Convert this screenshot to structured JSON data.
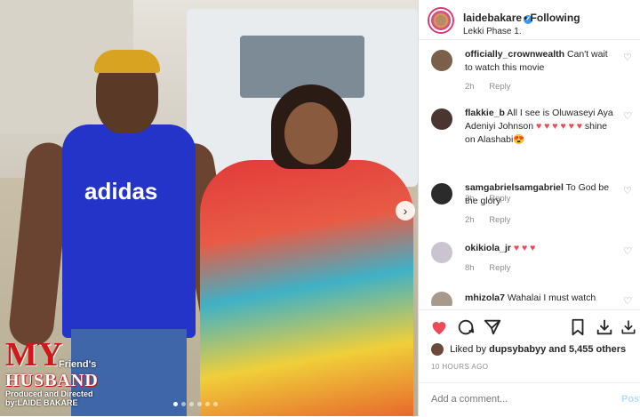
{
  "post": {
    "poster_title_line1": "MY",
    "poster_title_friends": "Friend's",
    "poster_title_line2": "HUSBAND",
    "poster_credit_line1": "Produced and Directed",
    "poster_credit_line2": "by:LAIDE BAKARE",
    "shirt_text": "adidas",
    "carousel_dots": 6,
    "active_dot": 0
  },
  "header": {
    "username": "laidebakare",
    "follow_label": "Following",
    "location": "Lekki Phase 1."
  },
  "comments": [
    {
      "user": "officially_crownwealth",
      "text": "Can't wait to watch this movie",
      "hearts": "",
      "emoji": "",
      "time": "2h",
      "reply": "Reply",
      "avatar_color": "#7a6048"
    },
    {
      "user": "flakkie_b",
      "text": "All I see is Oluwaseyi Aya Adeniyi Johnson",
      "hearts": "♥ ♥ ♥ ♥ ♥ ♥",
      "text2": "shine on Alashabi",
      "emoji": "😍",
      "time": "2h",
      "reply": "Reply",
      "avatar_color": "#4a3530"
    },
    {
      "user": "samgabrielsamgabriel",
      "text": "To God be the glory",
      "hearts": "",
      "emoji": "",
      "time": "2h",
      "reply": "Reply",
      "avatar_color": "#2b2b2b"
    },
    {
      "user": "okikiola_jr",
      "text": "",
      "hearts": "♥ ♥ ♥",
      "emoji": "",
      "time": "8h",
      "reply": "Reply",
      "avatar_color": "#c9c4cf"
    },
    {
      "user": "mhizola7",
      "text": "Wahalai I must watch",
      "hearts": "",
      "emoji": "",
      "time": "",
      "reply": "",
      "avatar_color": "#a89a8a"
    }
  ],
  "likes": {
    "prefix": "Liked by",
    "user": "dupsybabyy",
    "suffix": "and 5,455 others"
  },
  "timestamp": "10 HOURS AGO",
  "add_comment": {
    "placeholder": "Add a comment...",
    "post_label": "Post"
  },
  "colors": {
    "like_heart": "#ed4956",
    "verified": "#3897f0",
    "post_disabled": "#b2dffc"
  }
}
